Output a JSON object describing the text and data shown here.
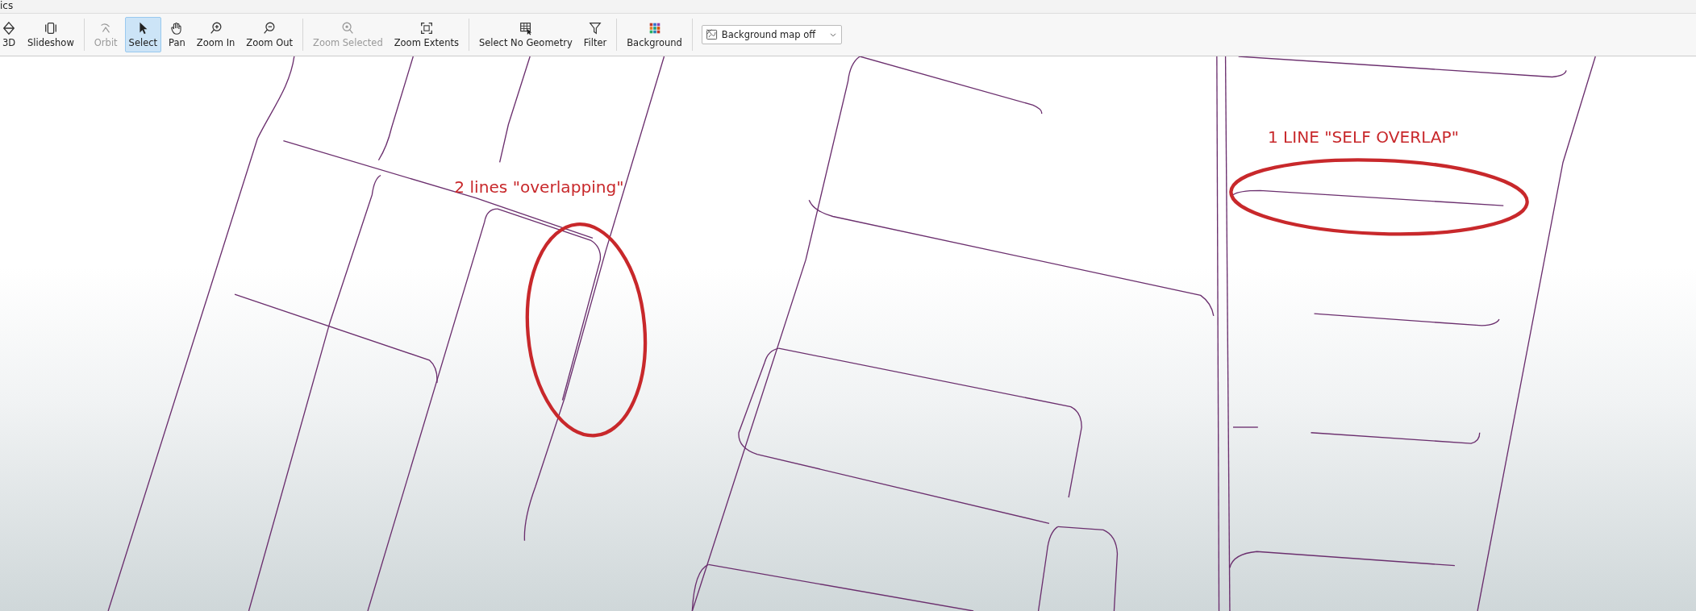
{
  "window": {
    "title": "ics"
  },
  "toolbar": [
    {
      "kind": "button",
      "label": "3D",
      "selected": false,
      "disabled": false
    },
    {
      "kind": "button",
      "label": "Slideshow",
      "selected": false,
      "disabled": false
    },
    {
      "kind": "separator"
    },
    {
      "kind": "button",
      "label": "Orbit",
      "selected": false,
      "disabled": true
    },
    {
      "kind": "button",
      "label": "Select",
      "selected": true,
      "disabled": false
    },
    {
      "kind": "button",
      "label": "Pan",
      "selected": false,
      "disabled": false
    },
    {
      "kind": "button",
      "label": "Zoom In",
      "selected": false,
      "disabled": false
    },
    {
      "kind": "button",
      "label": "Zoom Out",
      "selected": false,
      "disabled": false
    },
    {
      "kind": "separator"
    },
    {
      "kind": "button",
      "label": "Zoom Selected",
      "selected": false,
      "disabled": true
    },
    {
      "kind": "button",
      "label": "Zoom Extents",
      "selected": false,
      "disabled": false
    },
    {
      "kind": "separator"
    },
    {
      "kind": "button",
      "label": "Select No Geometry",
      "selected": false,
      "disabled": false
    },
    {
      "kind": "button",
      "label": "Filter",
      "selected": false,
      "disabled": false
    },
    {
      "kind": "separator"
    },
    {
      "kind": "button",
      "label": "Background",
      "selected": false,
      "disabled": false
    },
    {
      "kind": "separator"
    },
    {
      "kind": "dropdown",
      "value": "Background map off"
    }
  ],
  "annotations": [
    {
      "text": "2 lines \"overlapping\""
    },
    {
      "text": "1 LINE \"SELF OVERLAP\""
    }
  ]
}
